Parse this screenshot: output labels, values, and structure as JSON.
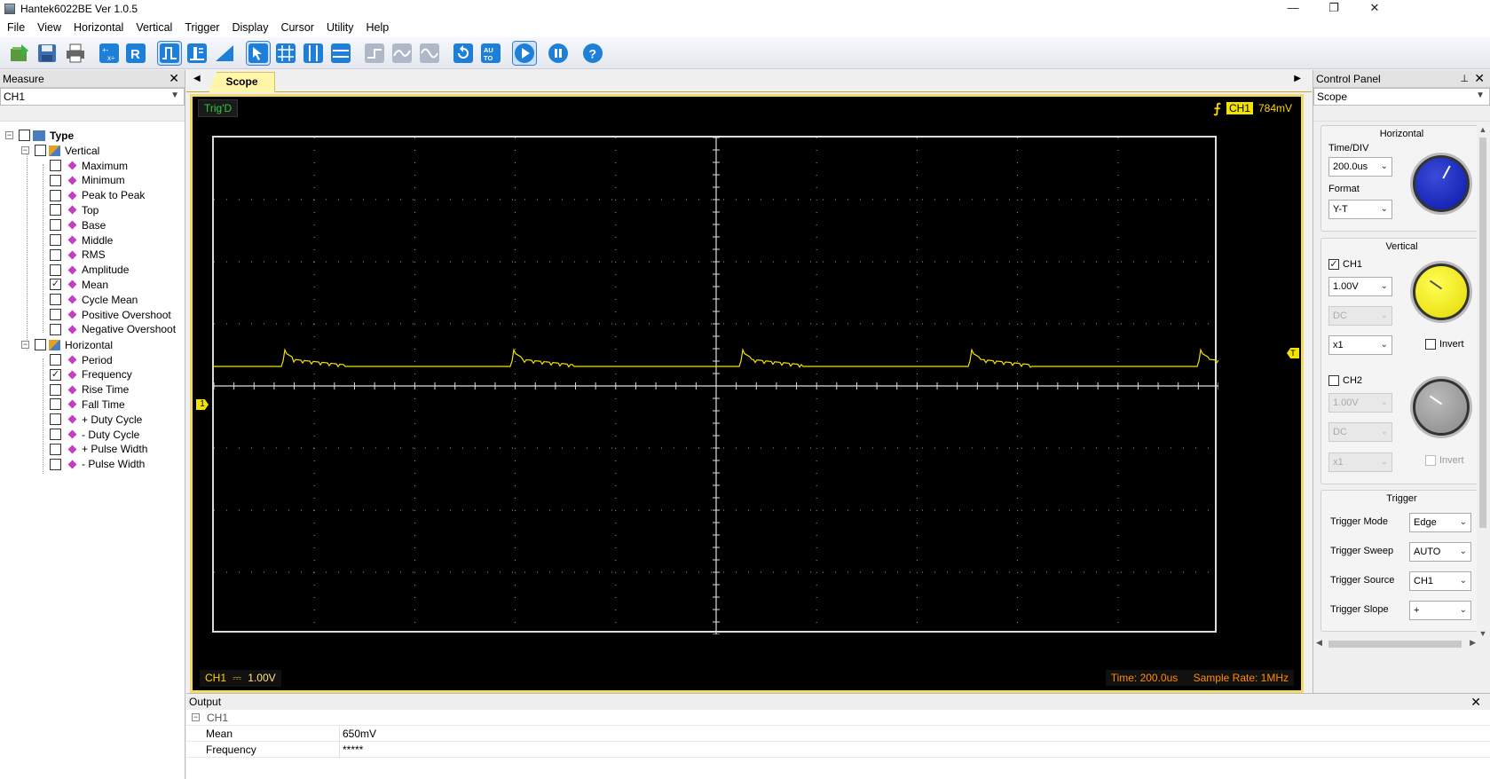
{
  "window": {
    "title": "Hantek6022BE Ver 1.0.5",
    "controls": {
      "minimize": "—",
      "maximize": "❐",
      "close": "✕"
    }
  },
  "menu": [
    "File",
    "View",
    "Horizontal",
    "Vertical",
    "Trigger",
    "Display",
    "Cursor",
    "Utility",
    "Help"
  ],
  "toolbar": {
    "icons": [
      "open-icon",
      "save-icon",
      "print-icon",
      "math-icon",
      "reference-icon",
      "ch1-channel-icon",
      "ch2-channel-icon",
      "ramp-icon",
      "cursor-select-icon",
      "grid-icon",
      "cursor-vertical-icon",
      "cursor-horizontal-icon",
      "step-icon",
      "smooth-wave-icon",
      "sine-wave-icon",
      "reset-icon",
      "auto-icon",
      "run-icon",
      "pause-icon",
      "help-icon"
    ],
    "auto_label": "AU TO"
  },
  "measure": {
    "title": "Measure",
    "close": "✕",
    "channel": "CH1",
    "tree": {
      "root": "Type",
      "vertical": {
        "label": "Vertical",
        "items": [
          {
            "label": "Maximum",
            "checked": false
          },
          {
            "label": "Minimum",
            "checked": false
          },
          {
            "label": "Peak to Peak",
            "checked": false
          },
          {
            "label": "Top",
            "checked": false
          },
          {
            "label": "Base",
            "checked": false
          },
          {
            "label": "Middle",
            "checked": false
          },
          {
            "label": "RMS",
            "checked": false
          },
          {
            "label": "Amplitude",
            "checked": false
          },
          {
            "label": "Mean",
            "checked": true
          },
          {
            "label": "Cycle Mean",
            "checked": false
          },
          {
            "label": "Positive Overshoot",
            "checked": false
          },
          {
            "label": "Negative Overshoot",
            "checked": false
          }
        ]
      },
      "horizontal": {
        "label": "Horizontal",
        "items": [
          {
            "label": "Period",
            "checked": false
          },
          {
            "label": "Frequency",
            "checked": true
          },
          {
            "label": "Rise Time",
            "checked": false
          },
          {
            "label": "Fall Time",
            "checked": false
          },
          {
            "label": "+ Duty Cycle",
            "checked": false
          },
          {
            "label": "- Duty Cycle",
            "checked": false
          },
          {
            "label": "+ Pulse Width",
            "checked": false
          },
          {
            "label": "- Pulse Width",
            "checked": false
          }
        ]
      }
    }
  },
  "scope": {
    "tab": "Scope",
    "status": "Trig'D",
    "trigger_channel": "CH1",
    "trigger_level": "784mV",
    "ch1_label": "CH1",
    "ch1_coupling_symbol": "⎓",
    "ch1_scale": "1.00V",
    "time": "Time: 200.0us",
    "sample_rate": "Sample Rate: 1MHz",
    "trigger_marker": "T",
    "channel_marker": "1",
    "colors": {
      "trace": "#f4e300",
      "background": "#000000",
      "grid": "#dddddd"
    }
  },
  "output": {
    "title": "Output",
    "close": "✕",
    "group": "CH1",
    "rows": [
      {
        "name": "Mean",
        "value": "650mV"
      },
      {
        "name": "Frequency",
        "value": "*****"
      }
    ]
  },
  "control": {
    "title": "Control Panel",
    "pin": "⊥",
    "close": "✕",
    "mode": "Scope",
    "horizontal": {
      "title": "Horizontal",
      "timediv_label": "Time/DIV",
      "timediv": "200.0us",
      "format_label": "Format",
      "format": "Y-T"
    },
    "vertical": {
      "title": "Vertical",
      "ch1": {
        "label": "CH1",
        "enabled": true,
        "volts": "1.00V",
        "coupling": "DC",
        "probe": "x1",
        "invert": "Invert"
      },
      "ch2": {
        "label": "CH2",
        "enabled": false,
        "volts": "1.00V",
        "coupling": "DC",
        "probe": "x1",
        "invert": "Invert"
      }
    },
    "trigger": {
      "title": "Trigger",
      "mode_label": "Trigger Mode",
      "mode": "Edge",
      "sweep_label": "Trigger Sweep",
      "sweep": "AUTO",
      "source_label": "Trigger Source",
      "source": "CH1",
      "slope_label": "Trigger Slope",
      "slope": "+"
    }
  }
}
